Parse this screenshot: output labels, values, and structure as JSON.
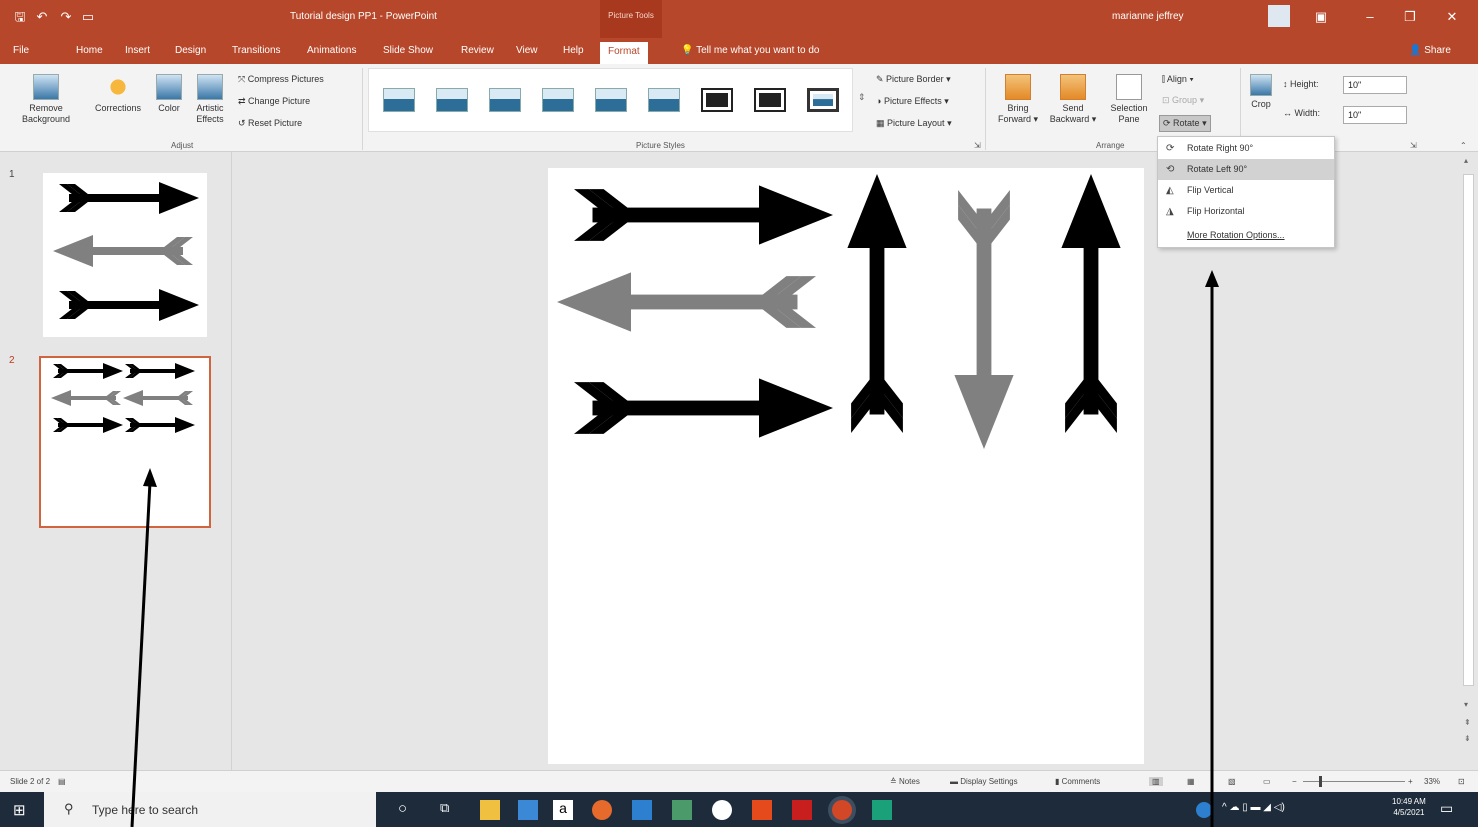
{
  "titlebar": {
    "doc_title": "Tutorial design PP1 - PowerPoint",
    "context_tools": "Picture Tools",
    "user_name": "marianne jeffrey",
    "minimize": "–",
    "restore": "❐",
    "close": "✕"
  },
  "tabs": [
    "File",
    "Home",
    "Insert",
    "Design",
    "Transitions",
    "Animations",
    "Slide Show",
    "Review",
    "View",
    "Help"
  ],
  "active_tab": "Format",
  "tell_me": "Tell me what you want to do",
  "share": "Share",
  "ribbon": {
    "adjust": {
      "remove_bg": [
        "Remove",
        "Background"
      ],
      "corrections": "Corrections",
      "color": "Color",
      "artistic": [
        "Artistic",
        "Effects"
      ],
      "compress": "Compress Pictures",
      "change": "Change Picture",
      "reset": "Reset Picture",
      "group_label": "Adjust"
    },
    "picture_styles": {
      "border": "Picture Border",
      "effects": "Picture Effects",
      "layout": "Picture Layout",
      "group_label": "Picture Styles"
    },
    "arrange": {
      "bring": [
        "Bring",
        "Forward"
      ],
      "send": [
        "Send",
        "Backward"
      ],
      "selection": [
        "Selection",
        "Pane"
      ],
      "align": "Align",
      "group": "Group",
      "rotate": "Rotate",
      "group_label": "Arrange"
    },
    "size": {
      "crop": "Crop",
      "height_label": "Height:",
      "height_value": "10\"",
      "width_label": "Width:",
      "width_value": "10\""
    }
  },
  "rotate_menu": {
    "items": [
      "Rotate Right 90°",
      "Rotate Left 90°",
      "Flip Vertical",
      "Flip Horizontal",
      "More Rotation Options..."
    ],
    "highlighted": "Rotate Left 90°"
  },
  "slides": {
    "numbers": [
      "1",
      "2"
    ],
    "selected": "2"
  },
  "statusbar": {
    "slide_info": "Slide 2 of 2",
    "notes": "Notes",
    "display": "Display Settings",
    "comments": "Comments",
    "zoom": "33%"
  },
  "taskbar": {
    "search_placeholder": "Type here to search",
    "time": "10:49 AM",
    "date": "4/5/2021"
  },
  "colors": {
    "accent": "#b7472a",
    "arrow_black": "#000000",
    "arrow_gray": "#808080"
  }
}
